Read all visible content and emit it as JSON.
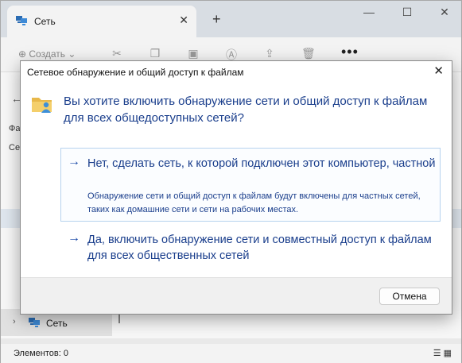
{
  "explorer": {
    "tab_title": "Сеть",
    "tab_close": "✕",
    "tab_add": "+",
    "window_controls": [
      "—",
      "☐",
      "✕"
    ],
    "toolbar": {
      "create_label": "⊕  Создать  ⌄",
      "more": "•••"
    },
    "nav_back": "←",
    "side_labels": [
      "Фа",
      "Се"
    ],
    "tree_item": {
      "chevron": "›",
      "label": "Сеть"
    },
    "status": "Элементов: 0"
  },
  "dialog": {
    "title": "Сетевое обнаружение и общий доступ к файлам",
    "close": "✕",
    "question": "Вы хотите включить обнаружение сети и общий доступ к файлам для всех общедоступных сетей?",
    "options": [
      {
        "arrow": "→",
        "main": "Нет, сделать сеть, к которой подключен этот компьютер, частной",
        "sub": "Обнаружение сети и общий доступ к файлам будут включены для частных сетей, таких как домашние сети и сети на рабочих местах."
      },
      {
        "arrow": "→",
        "main": "Да, включить обнаружение сети и совместный доступ к файлам для всех общественных сетей",
        "sub": ""
      }
    ],
    "cancel_label": "Отмена"
  },
  "colors": {
    "link_blue": "#1a3e8c",
    "hover_border": "#b7d3ee",
    "footer_bg": "#f0f0f0"
  }
}
